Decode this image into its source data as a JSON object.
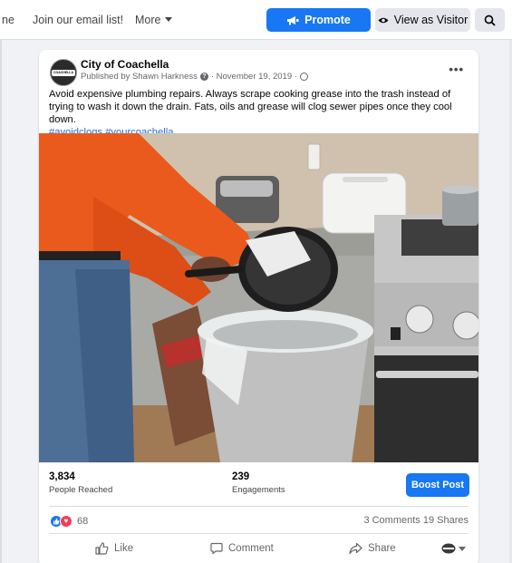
{
  "nav": {
    "home_partial": "ne",
    "email_list": "Join our email list!",
    "more": "More",
    "promote": "Promote",
    "view_as_visitor": "View as Visitor"
  },
  "post": {
    "page_name": "City of Coachella",
    "published_by": "Published by Shawn Harkness",
    "date": "· November 19, 2019 ·",
    "text": "Avoid expensive plumbing repairs. Always scrape cooking grease into the trash instead of trying to wash it down the drain. Fats, oils and grease will clog sewer pipes once they cool down.",
    "hashtags": "#avoidclogs #yourcoachella",
    "avatar_text": "COACHELLA"
  },
  "stats": {
    "reached_value": "3,834",
    "reached_label": "People Reached",
    "engagements_value": "239",
    "engagements_label": "Engagements",
    "boost": "Boost Post"
  },
  "reactions": {
    "count": "68",
    "comments_shares": "3 Comments  19 Shares"
  },
  "actions": {
    "like": "Like",
    "comment": "Comment",
    "share": "Share"
  },
  "colors": {
    "accent": "#1877f2",
    "love": "#f33e58",
    "hashtag": "#216fdb"
  }
}
